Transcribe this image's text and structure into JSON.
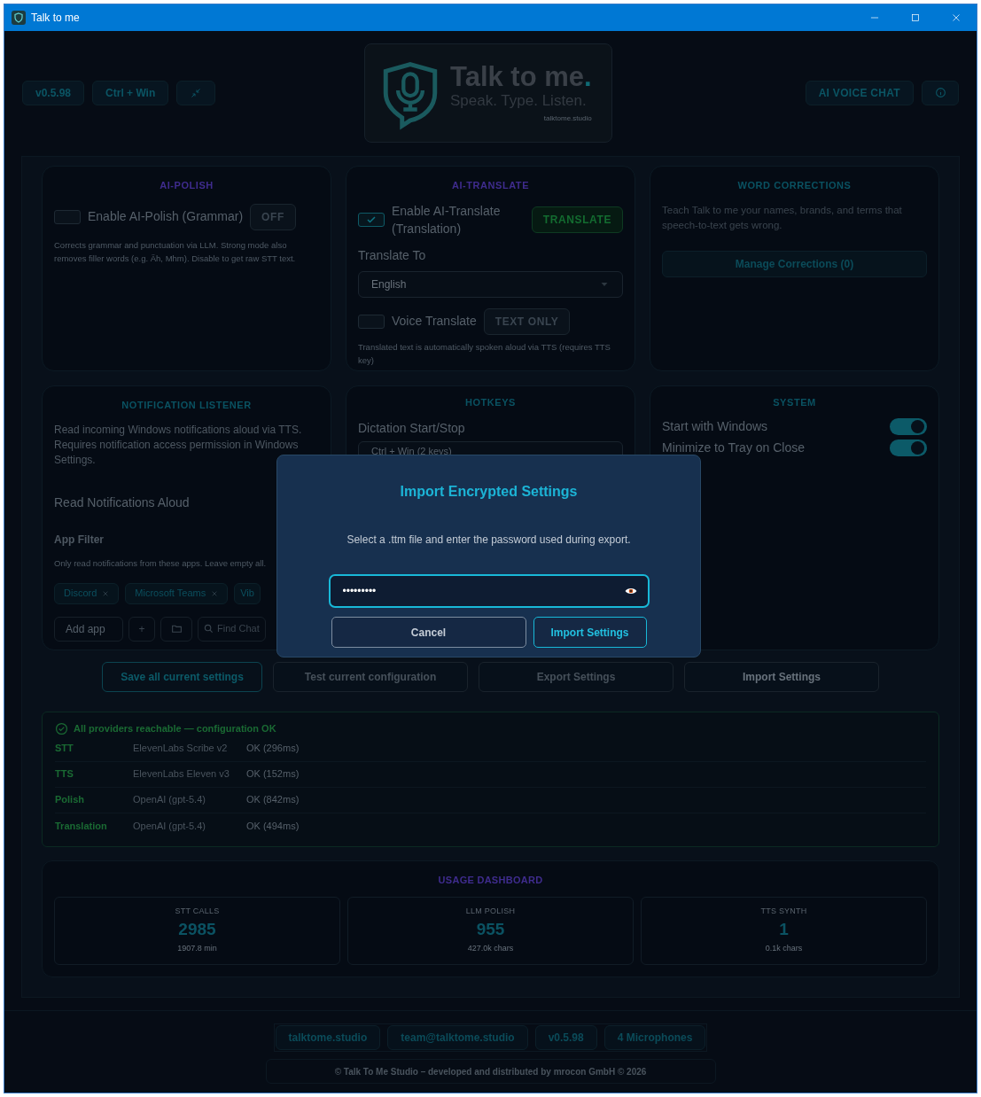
{
  "window": {
    "title": "Talk to me"
  },
  "header": {
    "left_buttons": [
      "v0.5.98",
      "Ctrl + Win"
    ],
    "right_button": "AI VOICE CHAT"
  },
  "logo": {
    "title": "Talk to me",
    "title_mark": ".",
    "tagline": "Speak. Type. Listen.",
    "url": "talktome.studio"
  },
  "ai_polish": {
    "title": "AI-POLISH",
    "toggle": {
      "label": "Enable AI-Polish (Grammar)",
      "checked": false
    },
    "badge": "OFF",
    "description": "Corrects grammar and punctuation via LLM. Strong mode also removes filler words (e.g. Äh, Mhm). Disable to get raw STT text."
  },
  "ai_translate": {
    "title": "AI-TRANSLATE",
    "toggle": {
      "label": "Enable AI-Translate (Translation)",
      "checked": true
    },
    "badge": "TRANSLATE",
    "target_label": "Translate To",
    "target_value": "English",
    "voice": {
      "label": "Voice Translate",
      "checked": false
    },
    "voice_badge": "TEXT ONLY",
    "description": "Translated text is automatically spoken aloud via TTS (requires TTS key)"
  },
  "word_corrections": {
    "title": "WORD CORRECTIONS",
    "description": "Teach Talk to me your names, brands, and terms that speech-to-text gets wrong.",
    "button": "Manage Corrections (0)"
  },
  "notification_listener": {
    "title": "NOTIFICATION LISTENER",
    "description": "Read incoming Windows notifications aloud via TTS. Requires notification access permission in Windows Settings.",
    "setting_label": "Read Notifications Aloud",
    "filter_label": "App Filter",
    "filter_hint": "Only read notifications from these apps. Leave empty all.",
    "apps": [
      "Discord",
      "Microsoft Teams",
      "Vib"
    ],
    "add_placeholder": "Add app",
    "add_button": "+",
    "find_button": "Find Chat"
  },
  "hotkeys": {
    "title": "HOTKEYS",
    "label": "Dictation Start/Stop",
    "value": "Ctrl + Win (2 keys)"
  },
  "system": {
    "title": "SYSTEM",
    "options": [
      {
        "label": "Start with Windows",
        "on": true
      },
      {
        "label": "Minimize to Tray on Close",
        "on": true
      }
    ]
  },
  "actions": [
    {
      "label": "Save all current settings",
      "kind": "primary"
    },
    {
      "label": "Test current configuration",
      "kind": "muted"
    },
    {
      "label": "Export Settings",
      "kind": "muted"
    },
    {
      "label": "Import Settings",
      "kind": "default"
    }
  ],
  "test_results": {
    "summary": "All providers reachable — configuration OK",
    "rows": [
      {
        "service": "STT",
        "provider": "ElevenLabs Scribe v2",
        "result": "OK (296ms)"
      },
      {
        "service": "TTS",
        "provider": "ElevenLabs Eleven v3",
        "result": "OK (152ms)"
      },
      {
        "service": "Polish",
        "provider": "OpenAI (gpt-5.4)",
        "result": "OK (842ms)"
      },
      {
        "service": "Translation",
        "provider": "OpenAI (gpt-5.4)",
        "result": "OK (494ms)"
      }
    ]
  },
  "usage": {
    "title": "USAGE DASHBOARD",
    "stats": [
      {
        "label": "STT CALLS",
        "value": "2985",
        "detail": "1907.8 min"
      },
      {
        "label": "LLM POLISH",
        "value": "955",
        "detail": "427.0k chars"
      },
      {
        "label": "TTS SYNTH",
        "value": "1",
        "detail": "0.1k chars"
      }
    ]
  },
  "footer": {
    "links": [
      "talktome.studio",
      "team@talktome.studio",
      "v0.5.98",
      "4 Microphones"
    ],
    "copyright": "© Talk To Me Studio – developed and distributed by mrocon GmbH © 2026"
  },
  "dialog": {
    "title": "Import Encrypted Settings",
    "message": "Select a .ttm file and enter the password used during export.",
    "password": "•••••••••",
    "cancel": "Cancel",
    "confirm": "Import Settings"
  }
}
